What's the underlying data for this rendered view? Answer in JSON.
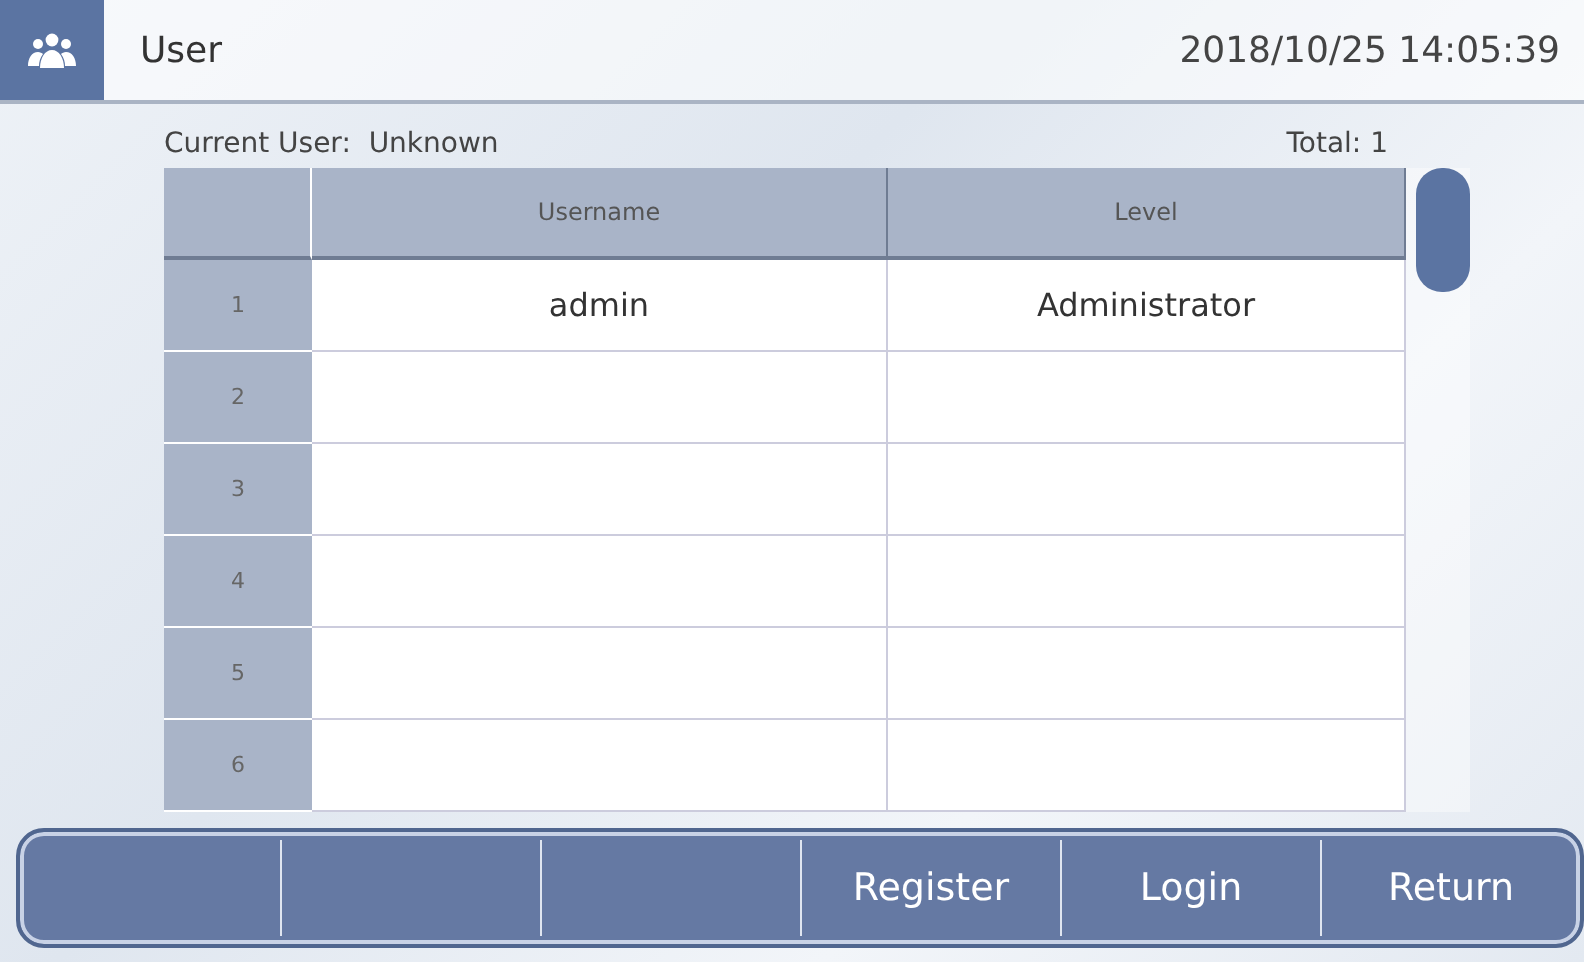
{
  "header": {
    "title": "User",
    "datetime": "2018/10/25  14:05:39"
  },
  "summary": {
    "current_user_label": "Current User:",
    "current_user": "Unknown",
    "total_label": "Total:",
    "total": "1"
  },
  "table": {
    "columns": [
      "Username",
      "Level"
    ],
    "rows": [
      {
        "number": "1",
        "username": "admin",
        "level": "Administrator"
      },
      {
        "number": "2"
      },
      {
        "number": "3"
      },
      {
        "number": "4"
      },
      {
        "number": "5"
      },
      {
        "number": "6"
      }
    ]
  },
  "buttons": [
    {
      "kind": "blank"
    },
    {
      "kind": "blank"
    },
    {
      "kind": "blank"
    },
    {
      "kind": "action",
      "label": "Register"
    },
    {
      "kind": "action",
      "label": "Login"
    },
    {
      "kind": "action",
      "label": "Return"
    }
  ]
}
